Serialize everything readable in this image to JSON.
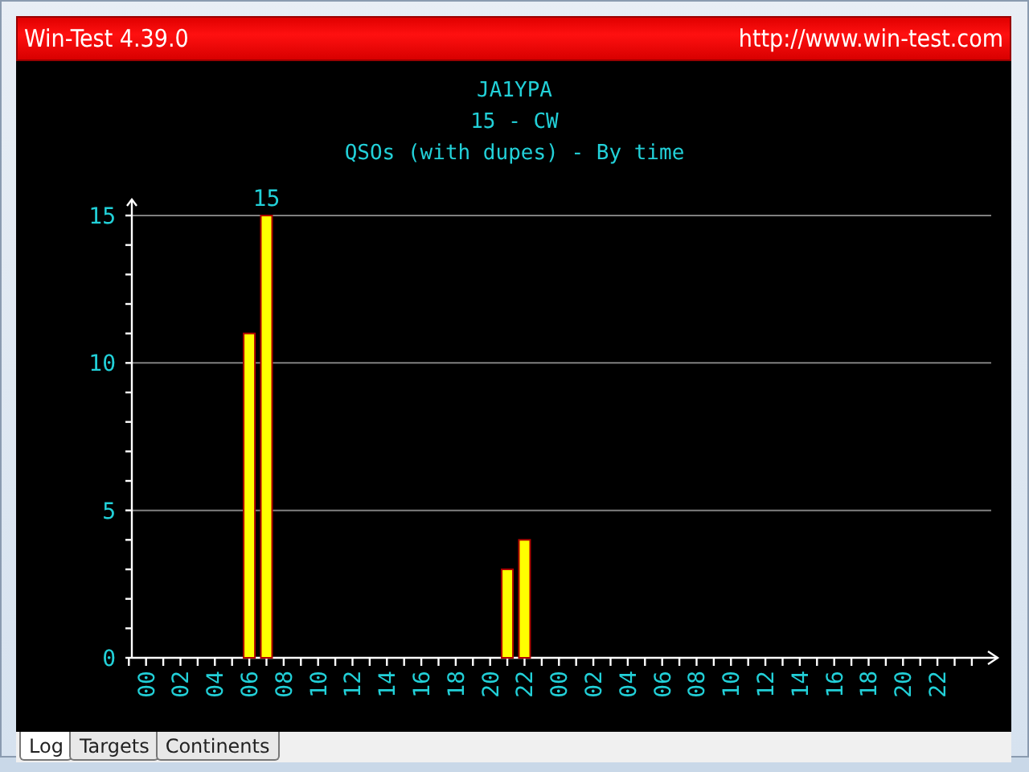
{
  "window": {
    "title": "Win-Test 4.39.0",
    "url": "http://www.win-test.com"
  },
  "chart": {
    "heading": [
      "JA1YPA",
      "15 - CW"
    ],
    "chart_data": {
      "type": "bar",
      "title": "QSOs (with dupes) - By time",
      "x": [
        6,
        7,
        21,
        22
      ],
      "values": [
        11,
        15,
        3,
        4
      ],
      "xlim": [
        -1.2,
        49.5
      ],
      "ylim": [
        0,
        15
      ],
      "yticks": [
        0,
        5,
        10,
        15
      ],
      "xticks": [
        {
          "value": 0,
          "label": "00"
        },
        {
          "value": 2,
          "label": "02"
        },
        {
          "value": 4,
          "label": "04"
        },
        {
          "value": 6,
          "label": "06"
        },
        {
          "value": 8,
          "label": "08"
        },
        {
          "value": 10,
          "label": "10"
        },
        {
          "value": 12,
          "label": "12"
        },
        {
          "value": 14,
          "label": "14"
        },
        {
          "value": 16,
          "label": "16"
        },
        {
          "value": 18,
          "label": "18"
        },
        {
          "value": 20,
          "label": "20"
        },
        {
          "value": 22,
          "label": "22"
        },
        {
          "value": 24,
          "label": "00"
        },
        {
          "value": 26,
          "label": "02"
        },
        {
          "value": 28,
          "label": "04"
        },
        {
          "value": 30,
          "label": "06"
        },
        {
          "value": 32,
          "label": "08"
        },
        {
          "value": 34,
          "label": "10"
        },
        {
          "value": 36,
          "label": "12"
        },
        {
          "value": 38,
          "label": "14"
        },
        {
          "value": 40,
          "label": "16"
        },
        {
          "value": 42,
          "label": "18"
        },
        {
          "value": 44,
          "label": "20"
        },
        {
          "value": 46,
          "label": "22"
        }
      ],
      "annotations": [
        {
          "x": 7,
          "y": 15,
          "text": "15"
        }
      ]
    }
  },
  "tabs": [
    {
      "label": "Log",
      "selected": true
    },
    {
      "label": "Targets",
      "selected": false
    },
    {
      "label": "Continents",
      "selected": false
    }
  ]
}
